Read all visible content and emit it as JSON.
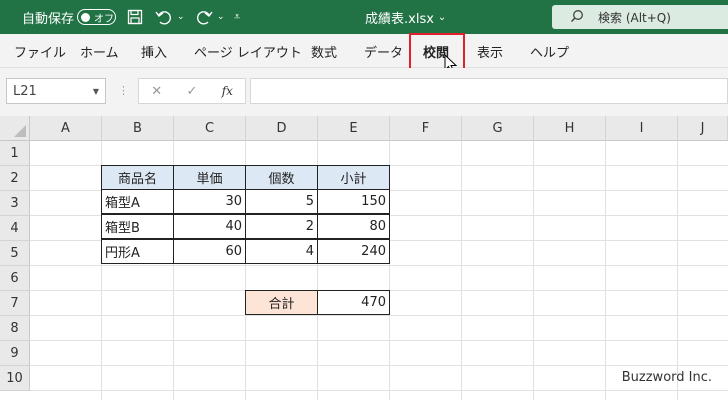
{
  "titlebar": {
    "autosave_label": "自動保存",
    "autosave_state": "オフ",
    "file_title": "成績表.xlsx",
    "search_label": "検索 (Alt+Q)"
  },
  "ribbon": {
    "tabs": [
      "ファイル",
      "ホーム",
      "挿入",
      "ページ レイアウト",
      "数式",
      "データ",
      "校閲",
      "表示",
      "ヘルプ"
    ],
    "active_tab": "校閲"
  },
  "formula_bar": {
    "name_box": "L21",
    "formula": ""
  },
  "sheet": {
    "columns": [
      "A",
      "B",
      "C",
      "D",
      "E",
      "F",
      "G",
      "H",
      "I",
      "J"
    ],
    "rows": [
      "1",
      "2",
      "3",
      "4",
      "5",
      "6",
      "7",
      "8",
      "9",
      "10"
    ],
    "table": {
      "headers": [
        "商品名",
        "単価",
        "個数",
        "小計"
      ],
      "rows": [
        [
          "箱型A",
          "30",
          "5",
          "150"
        ],
        [
          "箱型B",
          "40",
          "2",
          "80"
        ],
        [
          "円形A",
          "60",
          "4",
          "240"
        ]
      ],
      "total_label": "合計",
      "total_value": "470"
    }
  },
  "watermark": "Buzzword Inc.",
  "colors": {
    "title_bar": "#217346",
    "header_fill": "#dde8f5",
    "total_fill": "#fce4d6",
    "highlight": "#e0202a"
  }
}
